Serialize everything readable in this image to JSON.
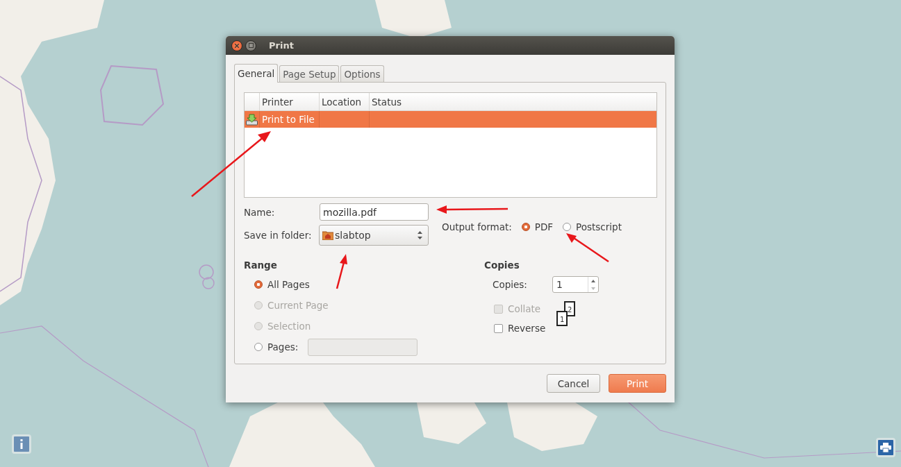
{
  "window": {
    "title": "Print"
  },
  "tabs": [
    {
      "label": "General",
      "selected": true
    },
    {
      "label": "Page Setup",
      "selected": false
    },
    {
      "label": "Options",
      "selected": false
    }
  ],
  "printers": {
    "columns": [
      "Printer",
      "Location",
      "Status"
    ],
    "rows": [
      {
        "printer": "Print to File",
        "selected": true
      }
    ]
  },
  "name_field": {
    "label": "Name:",
    "value": "mozilla.pdf"
  },
  "folder_field": {
    "label": "Save in folder:",
    "value": "slabtop"
  },
  "output_format": {
    "label": "Output format:",
    "options": [
      {
        "label": "PDF",
        "selected": true
      },
      {
        "label": "Postscript",
        "selected": false
      }
    ]
  },
  "range": {
    "heading": "Range",
    "options": [
      {
        "label": "All Pages",
        "selected": true,
        "disabled": false,
        "kind": "plain"
      },
      {
        "label": "Current Page",
        "selected": false,
        "disabled": true,
        "kind": "plain"
      },
      {
        "label": "Selection",
        "selected": false,
        "disabled": true,
        "kind": "plain"
      },
      {
        "label": "Pages:",
        "selected": false,
        "disabled": false,
        "kind": "pages"
      }
    ]
  },
  "copies": {
    "heading": "Copies",
    "label": "Copies:",
    "value": "1",
    "collate": {
      "label": "Collate",
      "checked": false,
      "disabled": true
    },
    "reverse": {
      "label": "Reverse",
      "checked": false,
      "disabled": false
    },
    "sheet_numbers": [
      "1",
      "2"
    ]
  },
  "buttons": [
    {
      "label": "Cancel",
      "kind": "secondary"
    },
    {
      "label": "Print",
      "kind": "primary"
    }
  ]
}
